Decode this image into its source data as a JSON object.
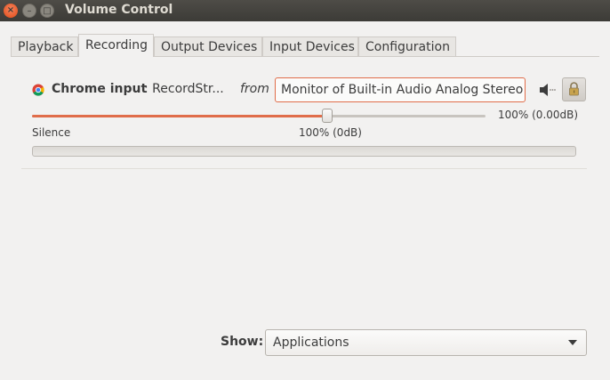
{
  "window": {
    "title": "Volume Control",
    "controls": {
      "close": "×",
      "minimize": "–",
      "maximize": "□"
    }
  },
  "tabs": [
    {
      "label": "Playback",
      "active": false
    },
    {
      "label": "Recording",
      "active": true
    },
    {
      "label": "Output Devices",
      "active": false
    },
    {
      "label": "Input Devices",
      "active": false
    },
    {
      "label": "Configuration",
      "active": false
    }
  ],
  "stream": {
    "icon": "chrome-icon",
    "app_name": "Chrome input",
    "stream_name": ": RecordStr...",
    "from_label": "from",
    "device": "Monitor of Built-in Audio Analog Stereo",
    "mute_icon": "speaker-icon",
    "lock_icon": "lock-icon",
    "volume_fraction": 0.65,
    "volume_text": "100% (0.00dB)",
    "mark_silence": "Silence",
    "mark_100": "100% (0dB)",
    "level_fraction": 0
  },
  "footer": {
    "show_label": "Show:",
    "show_value": "Applications"
  },
  "colors": {
    "accent": "#e06d4a",
    "titlebar": "#3c3b37",
    "background": "#f2f1f0"
  }
}
